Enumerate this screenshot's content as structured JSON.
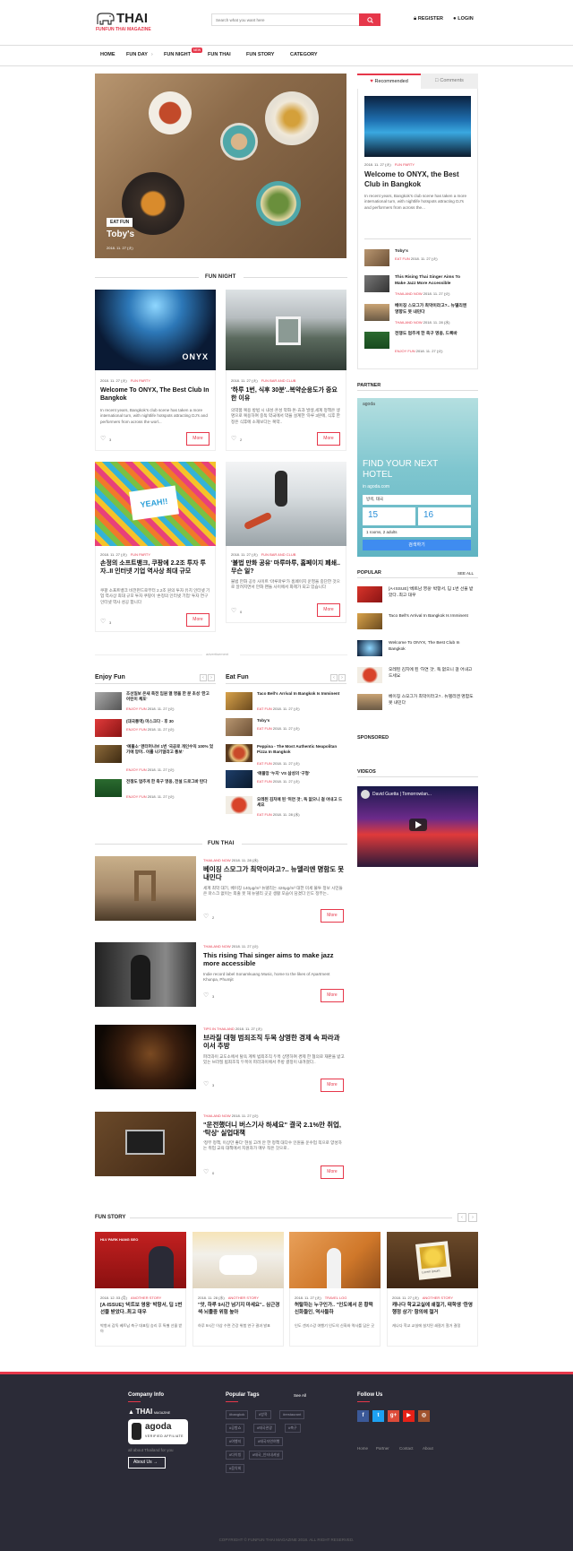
{
  "header": {
    "logo_main": "THAI",
    "logo_sub": "FUNFUN THAI MAGAZINE",
    "search_placeholder": "Search what you want here",
    "register": "REGISTER",
    "login": "LOGIN"
  },
  "nav": {
    "items": [
      "HOME",
      "FUN DAY",
      "FUN NIGHT",
      "FUN THAI",
      "FUN STORY",
      "CATEGORY"
    ],
    "badge": "NEW"
  },
  "hero": {
    "tag": "EAT FUN",
    "title": "Toby's",
    "date": "2018. 11. 27 (火)"
  },
  "sidebar_tabs": {
    "recommended": "Recommended",
    "comments": "Comments"
  },
  "recommended": {
    "date": "2018. 11. 27 (火)",
    "cat": "FUN PARTY",
    "title": "Welcome to ONYX, the Best Club in Bangkok",
    "excerpt": "In recent years, Bangkok's club scene has taken a more international turn, with nightlife hotspots attracting DJ's and performers from across the...",
    "list": [
      {
        "title": "Toby's",
        "cat": "EAT FUN",
        "date": "2018. 11. 27 (火)"
      },
      {
        "title": "This Rising Thai Singer Aims To Make Jazz More Accessible",
        "cat": "THAILAND NOW",
        "date": "2018. 11. 27 (火)"
      },
      {
        "title": "베이징 스모그가 최악이라고?.. 뉴델리엔 영향도 못 내민다",
        "cat": "THAILAND NOW",
        "date": "2018. 11. 28 (水)"
      },
      {
        "title": "전쟁도 멈추게 한 축구 영웅, 드록바",
        "cat": "ENJOY FUN",
        "date": "2018. 11. 27 (火)"
      }
    ]
  },
  "fun_night": {
    "section_title": "FUN NIGHT",
    "cards": [
      {
        "date": "2018. 11. 27 (火)",
        "cat": "FUN PARTY",
        "title": "Welcome To ONYX, The Best Club In Bangkok",
        "excerpt": "In recent years, Bangkok's club scene has taken a more international turn, with nightlife hotspots attracting DJ's and performers from across the worl...",
        "likes": "3",
        "more": "More",
        "photo_text": "ONYX"
      },
      {
        "date": "2018. 11. 27 (火)",
        "cat": "FUN BAR AND CLUB",
        "title": "'하루 1번, 식후 30분'..복약순응도가 중요한 이유",
        "excerpt": "의약품 복용 방법 시 내성·흔성 약화·돈·효과 발생,세계 정책은 생명으로 복용하여 중독 약국에서 약을 설계한 '하루 3분에, 식후 한 정은 식후에 소재보다는 복약..",
        "likes": "2",
        "more": "More"
      },
      {
        "date": "2018. 11. 27 (火)",
        "cat": "FUN PARTY",
        "title": "손정의 소프트뱅크, 쿠팡에 2.2조 투자 투자..II 인터넷 기업 역사상 최대 규모",
        "excerpt": "쿠팡 소프트뱅크 비전펀드로부터 2.2조 원의 투자 유치 인터넷 기업 역사상 최대 규모 투자 쿠팡이 '손정의 인터넷 기업' 투자 연구 인터넷 역사 성공 합니다",
        "likes": "3",
        "more": "More",
        "photo_text": "YEAH!!"
      },
      {
        "date": "2018. 11. 27 (火)",
        "cat": "FUN BAR AND CLUB",
        "title": "'불법 만화 공유' 마루마루, 홈페이지 폐쇄.. 무슨 일?",
        "excerpt": "불법 만화 공유 사이트 '마루마루'가 홈페이지 운영을 중단한 것으로 알려지면서 만화 팬들 사이에서 화제가 되고 있습니다",
        "likes": "0",
        "more": "More"
      }
    ]
  },
  "advertisement": "advertisement",
  "enjoy_fun": {
    "title": "Enjoy Fun",
    "items": [
      {
        "title": "조선일보 온새 축전 임원 열 명을 한 분 초성 '한고 어린이 체포'",
        "cat": "ENJOY FUN",
        "date": "2018. 11. 27 (火)"
      },
      {
        "title": "(대국통역) 마스크다 - 후 30",
        "cat": "ENJOY FUN",
        "date": "2018. 11. 27 (火)"
      },
      {
        "title": "'예불소' 엔터머나브 1번 '국공로 개인수익 100% 었기에 망마.. 이를 나기얼라고 통보'",
        "cat": "ENJOY FUN",
        "date": "2018. 11. 27 (火)"
      },
      {
        "title": "전쟁도 멈추게 한 축구 영웅, 전설 드로그바 탄다",
        "cat": "ENJOY FUN",
        "date": "2018. 11. 27 (火)"
      }
    ]
  },
  "eat_fun": {
    "title": "Eat Fun",
    "items": [
      {
        "title": "Taco Bell's Arrival In Bangkok Is Imminent",
        "cat": "EAT FUN",
        "date": "2018. 11. 27 (火)"
      },
      {
        "title": "Toby's",
        "cat": "EAT FUN",
        "date": "2018. 11. 27 (火)"
      },
      {
        "title": "Peppina - The Most Authentic Neapolitan Pizza In Bangkok",
        "cat": "EAT FUN",
        "date": "2018. 11. 27 (火)"
      },
      {
        "title": "'애플망 '누지' VS 삼성의 '구형'",
        "cat": "EAT FUN",
        "date": "2018. 11. 27 (火)"
      },
      {
        "title": "오레된 김치에 된 '허연 것', 독 없으니 걸 어내고 드세요",
        "cat": "EAT FUN",
        "date": "2018. 11. 28 (水)"
      }
    ]
  },
  "fun_thai": {
    "section_title": "FUN THAI",
    "items": [
      {
        "cat": "THAILAND NOW",
        "date": "2018. 11. 28 (水)",
        "title": "베이징 스모그가 최악이라고?.. 뉴델리엔 명함도 못 내민다",
        "excerpt": "세계 최악 대기, 베이징 140μg/m³ 뉴델리는 426μg/m³ 대한 미세 불투 정보 시민들은 마스크 없이는 외출 못 해 뉴델리 곳곳 생활 모습이 담겼다 인도 정부는..",
        "likes": "2",
        "more": "More"
      },
      {
        "cat": "THAILAND NOW",
        "date": "2018. 11. 27 (火)",
        "title": "This rising Thai singer aims to make jazz more accessible",
        "excerpt": "Indie record label Sonamkuang Music, home to the likes of Apartment Khunpa, Phumjit",
        "likes": "3",
        "more": "More"
      },
      {
        "cat": "TIPS IN THAILAND",
        "date": "2018. 11. 27 (火)",
        "title": "브라질 대형 범죄조직 두목 상영한 경제 속 파라과이서 추방",
        "excerpt": "파라과이 교도소에서 탈옥 계획 범죄조직 두목 상영하여 경제 한 혐의로 재판을 받고 있는 브라질 범죄조직 두목이 파라과이에서 추방 결정이 내려졌다..",
        "likes": "3",
        "more": "More"
      },
      {
        "cat": "THAILAND NOW",
        "date": "2018. 11. 27 (火)",
        "title": "\"운전했더니 버스기사 하세요\" 결국 2.1%만 취업, '탁상' 실업대책",
        "excerpt": "'정부 정책, 이상만 좋다' 현실 고려 안 한 정책 대다수 인원을 운수업 쪽으로 양성하는 취업 교육 대책에서 지원자가 매우 적은 것으로..",
        "likes": "0",
        "more": "More"
      }
    ]
  },
  "fun_story": {
    "section_title": "FUN STORY",
    "cards": [
      {
        "date": "2018. 12. 03 (月)",
        "cat": "ANOTHER STORY",
        "title": "[A-ISSUE] '비트보 영웅' 박항서, 딥 1번 선물 받았다..최고 대우",
        "excerpt": "박항서 감독 베트남 축구 대표팀 승리 후 특별 선물 받아",
        "photo_text": "HLV PARK HANG SEO"
      },
      {
        "date": "2018. 11. 28 (水)",
        "cat": "ANOTHER STORY",
        "title": "\"앗, 하루 9시간 넘기지 마세요\".. 심근경색·뇌졸중 위험 높아",
        "excerpt": "하루 9시간 이상 수면 건강 위험 연구 결과 발표"
      },
      {
        "date": "2018. 11. 27 (火)",
        "cat": "TRAVEL LOG",
        "title": "허탈하는 누구인가.. \"인도에서 온 황떡 신화들인, 역사들하",
        "excerpt": "인도 갠지스강 여행기 인도의 신화와 역사를 담은 곳"
      },
      {
        "date": "2018. 11. 27 (火)",
        "cat": "ANOTHER STORY",
        "title": "캐나다 학교교실에 쇄절기, 태학생 '한영행정 상기' 항의에 철거",
        "excerpt": "캐나다 학교 교실에 설치된 쇄절기 철거 결정",
        "photo_text": "Lorem ipsum"
      }
    ]
  },
  "partner": {
    "title": "PARTNER",
    "ad_logo": "agoda",
    "ad_text": "FIND YOUR NEXT HOTEL",
    "ad_sub": "in agoda.com",
    "ad_input": "방콕, 태국",
    "ad_date1": "15",
    "ad_date2": "16",
    "ad_guests": "1 rooms, 2 adults",
    "ad_button": "검색하기"
  },
  "popular": {
    "title": "POPULAR",
    "see_all": "SEE ALL",
    "items": [
      "[A-ISSUE] '베트남 영웅' 박항서, 딥 1번 선물 받았다..최고 대우",
      "Taco Bell's Arrival In Bangkok Is Imminent",
      "Welcome To ONYX, The Best Club In Bangkok",
      "오레된 김치에 된 '허연 것', 독 없으니 걸 어내고 드세요",
      "베이징 스모그가 최악이라고?.. 뉴델리엔 명함도 못 내민다"
    ]
  },
  "sponsored": {
    "title": "SPONSORED"
  },
  "videos": {
    "title": "VIDEOS",
    "video_title": "David Guetta | Tomorrowlan..."
  },
  "footer": {
    "company_title": "Company Info",
    "logo_main": "THAI",
    "logo_sub": "MAGAZINE",
    "agoda_main": "agoda",
    "agoda_sub": "VERIFIED AFFILIATE",
    "tagline": "all about Thailand for you",
    "about_btn": "About Us",
    "tags_title": "Popular Tags",
    "see_all": "See All",
    "tags": [
      "#bangkok",
      "#방콕",
      "#restaurant",
      "#공항쇼",
      "#태국관광",
      "#축구",
      "#여행지",
      "#태국자연여행",
      "#다이빙",
      "#태국_인터내셔널",
      "#음악회"
    ],
    "follow_title": "Follow Us",
    "links": [
      "Home",
      "Partner",
      "Contact",
      "About"
    ],
    "copyright": "COPYRIGHT © FUNFUN THAI MAGAZINE 2018. ALL RIGHT RESERVED."
  },
  "colors": {
    "accent": "#e6374a",
    "footer_bg": "#2b2b37"
  }
}
